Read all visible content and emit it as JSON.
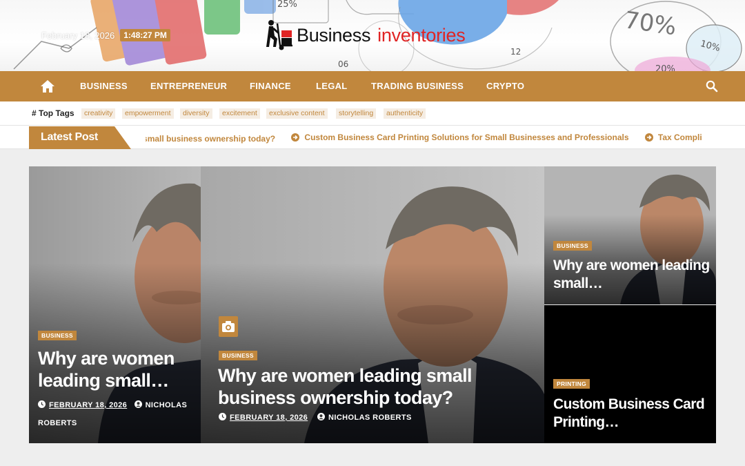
{
  "header": {
    "date": "February 18, 2026",
    "time": "1:48:27 PM",
    "logo": {
      "word1": "Business",
      "word2": "inventories",
      "icon": "hand-truck-icon"
    },
    "banner_figures": {
      "tl_percent": "25%",
      "pie_percent": "70%",
      "small_percent": "10%",
      "bottom_percent": "20%",
      "clock_12": "12",
      "clock_06": "06"
    }
  },
  "nav": {
    "home_icon": "home-icon",
    "items": [
      "BUSINESS",
      "ENTREPRENEUR",
      "FINANCE",
      "LEGAL",
      "TRADING BUSINESS",
      "CRYPTO"
    ],
    "search_icon": "search-icon"
  },
  "top_tags": {
    "title": "Top Tags",
    "tags": [
      "creativity",
      "empowerment",
      "diversity",
      "excitement",
      "exclusive content",
      "storytelling",
      "authenticity"
    ]
  },
  "ticker": {
    "label": "Latest Post",
    "items": [
      "Why are women leading small business ownership today?",
      "Custom Business Card Printing Solutions for Small Businesses and Professionals",
      "Tax Compli"
    ]
  },
  "cards": {
    "left": {
      "category": "BUSINESS",
      "title": "Why are women leading small…",
      "date": "FEBRUARY 18, 2026",
      "author": "NICHOLAS ROBERTS"
    },
    "center": {
      "category": "BUSINESS",
      "title": "Why are women leading small business ownership today?",
      "date": "FEBRUARY 18, 2026",
      "author": "NICHOLAS ROBERTS",
      "media_icon": "camera-icon"
    },
    "top_right": {
      "category": "BUSINESS",
      "title": "Why are women leading small…"
    },
    "bottom_right": {
      "category": "PRINTING",
      "title": "Custom Business Card Printing…"
    }
  },
  "colors": {
    "accent": "#c1873d",
    "logo_red": "#e02424",
    "page_bg": "#eeeeee"
  }
}
